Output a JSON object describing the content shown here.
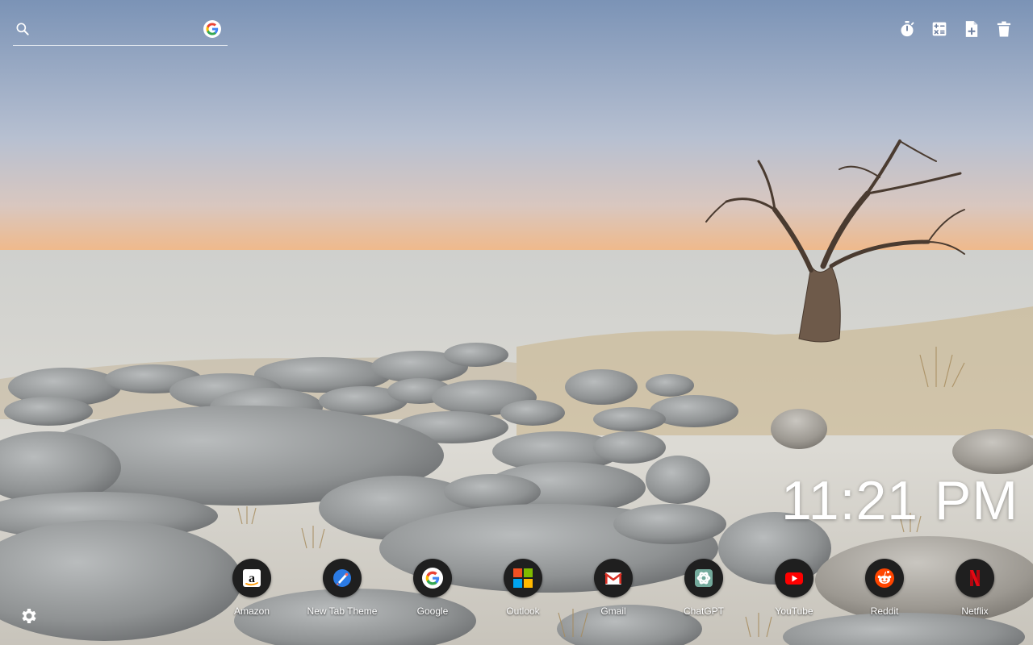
{
  "search": {
    "placeholder": "",
    "engine_icon": "google-g-icon"
  },
  "toolbar": {
    "icons": [
      "timer-icon",
      "calculator-icon",
      "add-note-icon",
      "trash-icon"
    ]
  },
  "clock": {
    "time": "11:21 PM"
  },
  "shortcuts": [
    {
      "label": "Amazon",
      "icon": "amazon-icon"
    },
    {
      "label": "New Tab Theme",
      "icon": "new-tab-theme-icon"
    },
    {
      "label": "Google",
      "icon": "google-icon"
    },
    {
      "label": "Outlook",
      "icon": "microsoft-icon"
    },
    {
      "label": "Gmail",
      "icon": "gmail-icon"
    },
    {
      "label": "ChatGPT",
      "icon": "chatgpt-icon"
    },
    {
      "label": "YouTube",
      "icon": "youtube-icon"
    },
    {
      "label": "Reddit",
      "icon": "reddit-icon"
    },
    {
      "label": "Netflix",
      "icon": "netflix-icon"
    }
  ],
  "settings": {
    "icon": "gear-icon"
  },
  "colors": {
    "sky_top": "#7b93b6",
    "horizon": "#f0b98a",
    "ground": "#d9d8d3",
    "shortcut_circle": "#1f1f1f"
  }
}
